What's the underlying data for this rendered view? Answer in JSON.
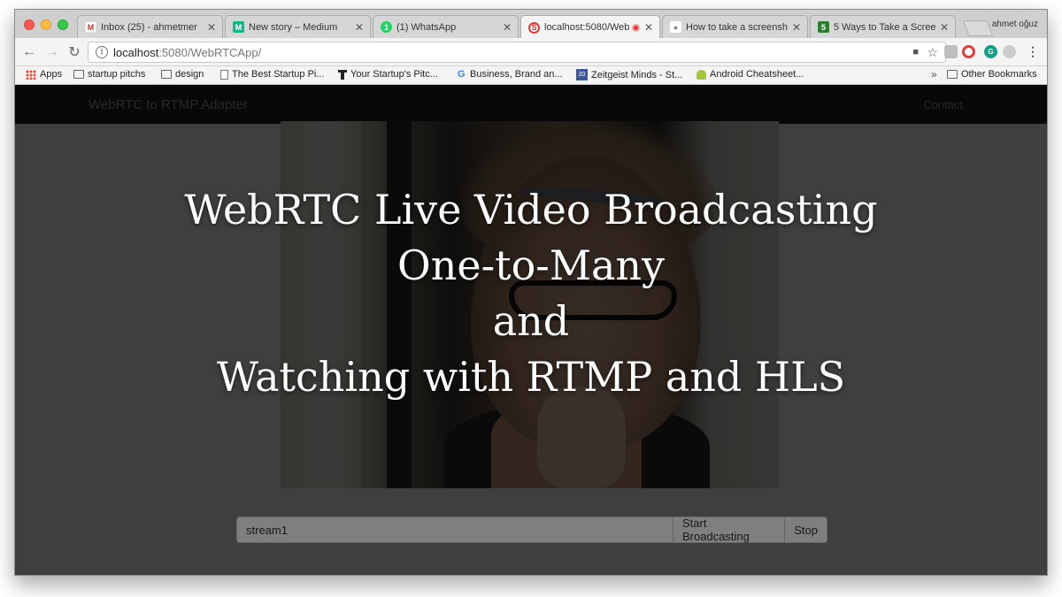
{
  "browser": {
    "tabs": [
      {
        "title": "Inbox (25) - ahmetmer",
        "favicon": "gmail-icon",
        "fav_letter": "M",
        "fav_color": "#ffffff"
      },
      {
        "title": "New story – Medium",
        "favicon": "medium-icon",
        "fav_letter": "M",
        "fav_color": "#12b886"
      },
      {
        "title": "(1) WhatsApp",
        "favicon": "whatsapp-icon",
        "fav_letter": "1",
        "fav_color": "#25d366"
      },
      {
        "title": "localhost:5080/Web",
        "favicon": "app-icon",
        "fav_letter": "S",
        "fav_color": "#e53935",
        "active": true,
        "recording": true
      },
      {
        "title": "How to take a screensh",
        "favicon": "apple-icon",
        "fav_letter": "",
        "fav_color": "#999999"
      },
      {
        "title": "5 Ways to Take a Scree",
        "favicon": "doc-icon",
        "fav_letter": "5",
        "fav_color": "#2e7d32"
      }
    ],
    "profile_name": "ahmet oğuz",
    "url_host": "localhost",
    "url_rest": ":5080/WebRTCApp/",
    "bookmarks": [
      {
        "label": "Apps",
        "icon": "apps-icon"
      },
      {
        "label": "startup pitchs",
        "icon": "folder-icon"
      },
      {
        "label": "design",
        "icon": "folder-icon"
      },
      {
        "label": "The Best Startup Pi...",
        "icon": "page-icon"
      },
      {
        "label": "Your Startup's Pitc...",
        "icon": "tower-icon"
      },
      {
        "label": "Business, Brand an...",
        "icon": "google-icon"
      },
      {
        "label": "Zeitgeist Minds - St...",
        "icon": "zeitgeist-icon"
      },
      {
        "label": "Android Cheatsheet...",
        "icon": "android-icon"
      }
    ],
    "bookmarks_overflow": "»",
    "other_bookmarks": "Other Bookmarks"
  },
  "page": {
    "brand": "WebRTC to RTMP Adapter",
    "nav_contact": "Contact",
    "stream_input_value": "stream1",
    "start_button": "Start Broadcasting",
    "stop_button": "Stop"
  },
  "headline": {
    "line1": "WebRTC Live Video Broadcasting",
    "line2": "One-to-Many",
    "line3": "and",
    "line4": "Watching with RTMP and HLS"
  },
  "colors": {
    "navbar": "#222222",
    "overlay": "rgba(0,0,0,0.5)",
    "recording": "#e53935"
  }
}
